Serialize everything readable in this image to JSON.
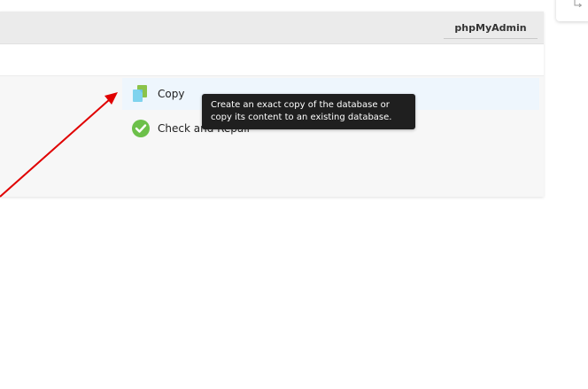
{
  "header": {
    "app_button_label": "phpMyAdmin"
  },
  "tools": {
    "copy": {
      "label": "Copy",
      "icon": "copy-database-icon"
    },
    "check_repair": {
      "label": "Check and Repair",
      "icon": "checkmark-circle-icon"
    }
  },
  "tooltip": {
    "text": "Create an exact copy of the database or copy its content to an existing database."
  },
  "colors": {
    "header_bg": "#ebebeb",
    "tools_bg": "#f7f7f7",
    "hover_row_bg": "#eef6fd",
    "tooltip_bg": "#1f1f1f",
    "check_green": "#6cc04a",
    "copy_blue": "#7fd3ee",
    "copy_green": "#8bc34a",
    "annotation_red": "#e00000"
  }
}
